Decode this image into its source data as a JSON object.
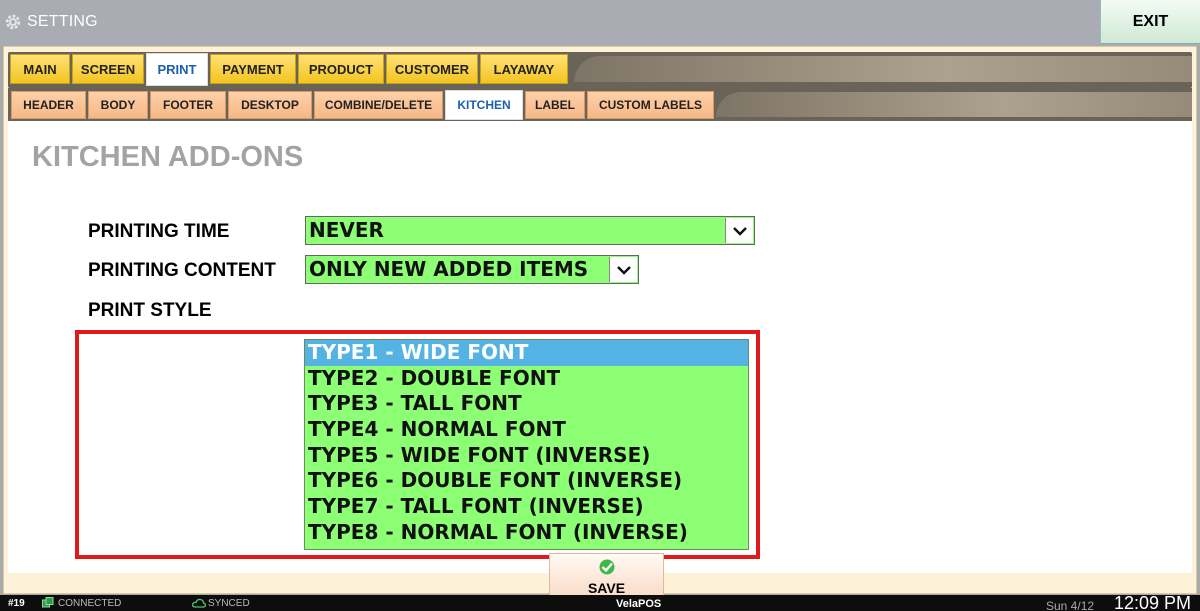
{
  "window": {
    "title": "SETTING",
    "exit_label": "EXIT"
  },
  "tabs": [
    {
      "label": "MAIN"
    },
    {
      "label": "SCREEN"
    },
    {
      "label": "PRINT",
      "active": true
    },
    {
      "label": "PAYMENT"
    },
    {
      "label": "PRODUCT"
    },
    {
      "label": "CUSTOMER"
    },
    {
      "label": "LAYAWAY"
    }
  ],
  "subtabs": [
    {
      "label": "HEADER"
    },
    {
      "label": "BODY"
    },
    {
      "label": "FOOTER"
    },
    {
      "label": "DESKTOP"
    },
    {
      "label": "COMBINE/DELETE"
    },
    {
      "label": "KITCHEN",
      "active": true
    },
    {
      "label": "LABEL"
    },
    {
      "label": "CUSTOM LABELS"
    }
  ],
  "section": {
    "title": "KITCHEN ADD-ONS"
  },
  "fields": {
    "printing_time": {
      "label": "PRINTING TIME",
      "value": "NEVER"
    },
    "printing_content": {
      "label": "PRINTING CONTENT",
      "value": "ONLY NEW ADDED ITEMS"
    },
    "print_style": {
      "label": "PRINT STYLE",
      "selected": "TYPE1 - WIDE FONT",
      "options": [
        "TYPE1 - WIDE FONT",
        "TYPE2 - DOUBLE FONT",
        "TYPE3 - TALL FONT",
        "TYPE4 - NORMAL FONT",
        "TYPE5 - WIDE FONT (INVERSE)",
        "TYPE6 - DOUBLE FONT (INVERSE)",
        "TYPE7 - TALL FONT (INVERSE)",
        "TYPE8 - NORMAL FONT (INVERSE)"
      ]
    }
  },
  "save": {
    "label": "SAVE",
    "icon": "checkmark-icon"
  },
  "status": {
    "station": "#19",
    "connection": "CONNECTED",
    "sync": "SYNCED",
    "brand": "VelaPOS",
    "date": "Sun 4/12",
    "time": "12:09 PM"
  },
  "colors": {
    "field_bg": "#8cff75",
    "highlight": "#e0191b",
    "selected_option": "#55b3e3",
    "tab_bg": "#f2c51f",
    "subtab_bg": "#f6b887"
  }
}
